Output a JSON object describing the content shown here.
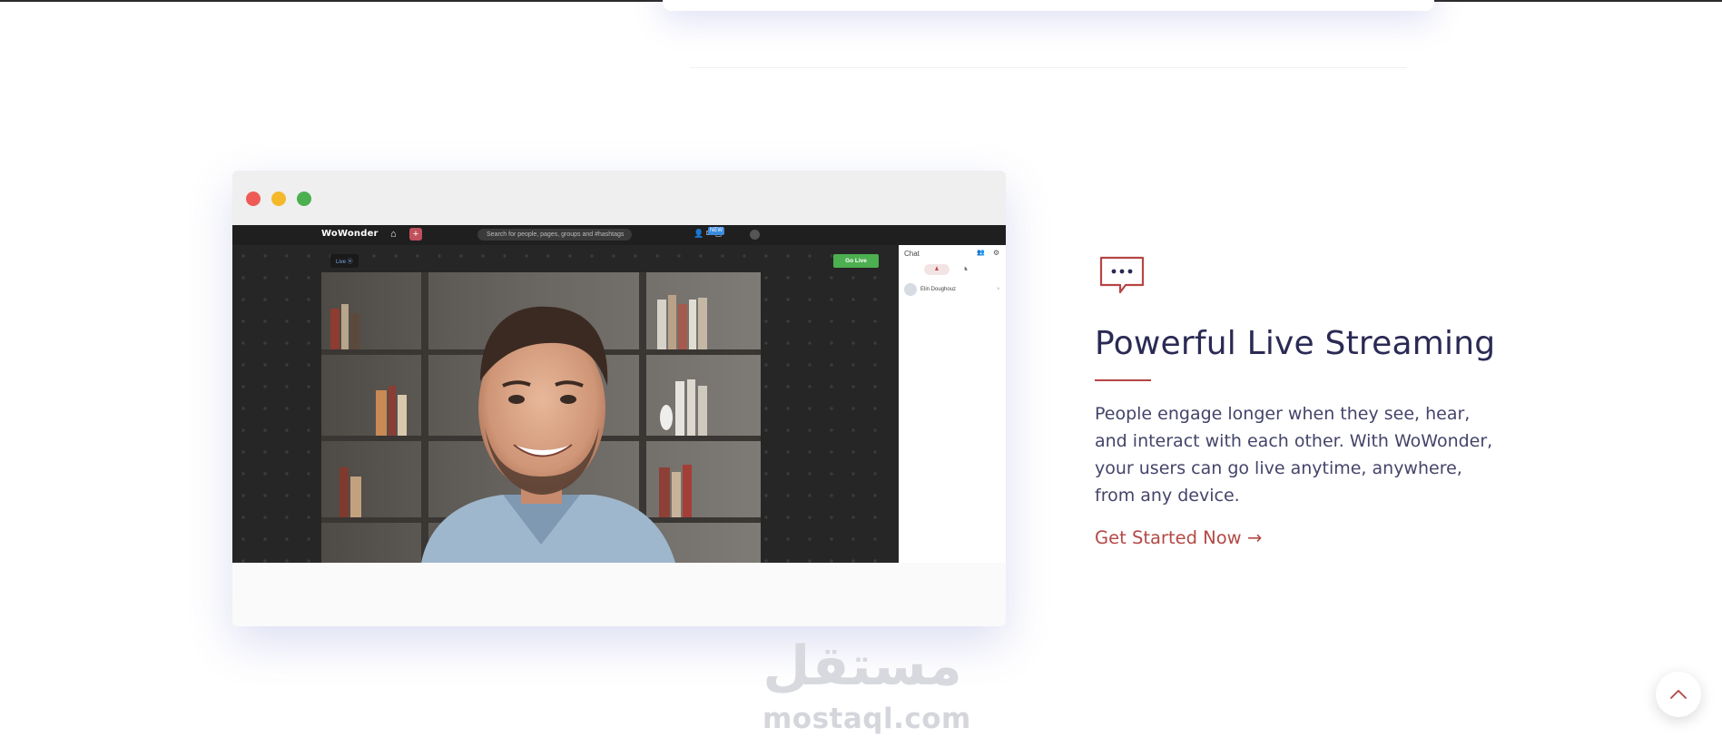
{
  "mock_window": {
    "app_logo": "WoWonder",
    "search_placeholder": "Search for people, pages, groups and #hashtags",
    "badge": "NEW",
    "live_tag": "Live ⦿",
    "go_live_label": "Go Live",
    "chat_title": "Chat",
    "chat_user": "Elin Doughouz",
    "colors": {
      "close": "#ee5b56",
      "minimize": "#f4b82a",
      "maximize": "#4caf50",
      "go_live": "#4caf50"
    }
  },
  "feature": {
    "icon": "chat-bubble-icon",
    "title": "Powerful Live Streaming",
    "description": "People engage longer when they see, hear, and interact with each other. With WoWonder, your users can go live anytime, anywhere, from any device.",
    "cta": "Get Started Now →",
    "accent_color": "#b64545",
    "title_color": "#2b2a55"
  },
  "watermark": {
    "arabic": "مستقل",
    "latin": "mostaql.com"
  },
  "scroll_top": {
    "icon": "chevron-up-icon"
  }
}
